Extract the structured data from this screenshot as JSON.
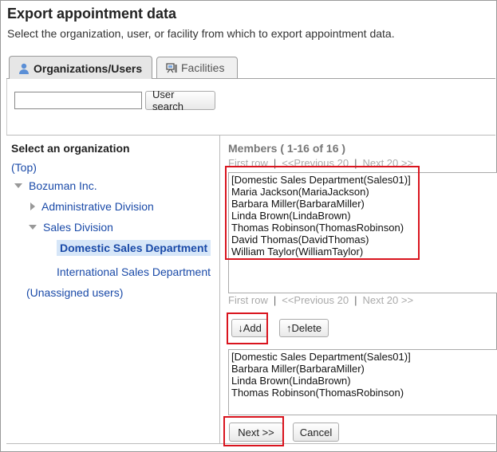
{
  "page": {
    "title": "Export appointment data",
    "description": "Select the organization, user, or facility from which to export appointment data."
  },
  "tabs": [
    {
      "label": "Organizations/Users",
      "icon": "user-icon",
      "active": true
    },
    {
      "label": "Facilities",
      "icon": "facility-icon",
      "active": false
    }
  ],
  "search": {
    "value": "",
    "button_label": "User search"
  },
  "org_tree": {
    "heading": "Select an organization",
    "items": [
      {
        "label": "(Top)"
      },
      {
        "label": "Bozuman Inc."
      },
      {
        "label": "Administrative Division"
      },
      {
        "label": "Sales Division"
      },
      {
        "label": "Domestic Sales Department",
        "selected": true
      },
      {
        "label": "International Sales Department"
      },
      {
        "label": "(Unassigned users)"
      }
    ]
  },
  "members": {
    "title": "Members ( 1-16 of 16 )",
    "pager": {
      "first": "First row",
      "prev": "<<Previous 20",
      "next": "Next 20 >>",
      "sep": "|"
    },
    "candidates": [
      "[Domestic Sales Department(Sales01)]",
      "Maria Jackson(MariaJackson)",
      "Barbara Miller(BarbaraMiller)",
      "Linda Brown(LindaBrown)",
      "Thomas Robinson(ThomasRobinson)",
      "David Thomas(DavidThomas)",
      "William Taylor(WilliamTaylor)"
    ],
    "add_label": "↓Add",
    "delete_label": "↑Delete",
    "selected": [
      "[Domestic Sales Department(Sales01)]",
      "Barbara Miller(BarbaraMiller)",
      "Linda Brown(LindaBrown)",
      "Thomas Robinson(ThomasRobinson)"
    ]
  },
  "actions": {
    "next_label": "Next >>",
    "cancel_label": "Cancel"
  },
  "colors": {
    "link": "#1a4aa8",
    "highlight": "#d9141e",
    "selected_bg": "#d6e6f8"
  }
}
